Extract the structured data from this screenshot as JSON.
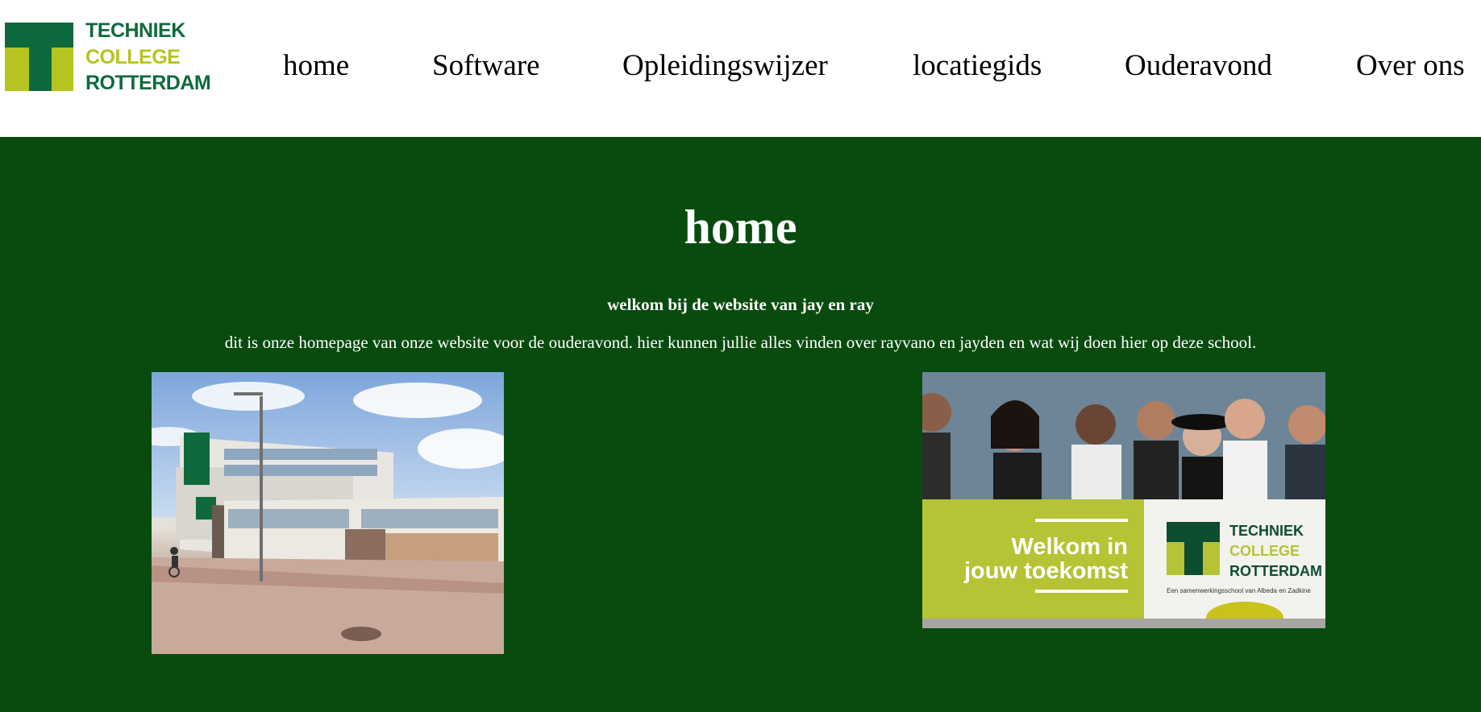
{
  "logo": {
    "line1": "TECHNIEK",
    "line2": "COLLEGE",
    "line3": "ROTTERDAM",
    "colors": {
      "green": "#0e6a3c",
      "yellow": "#b6c41f"
    }
  },
  "nav": {
    "items": [
      {
        "label": "home"
      },
      {
        "label": "Software"
      },
      {
        "label": "Opleidingswijzer"
      },
      {
        "label": "locatiegids"
      },
      {
        "label": "Ouderavond"
      },
      {
        "label": "Over ons"
      }
    ]
  },
  "main": {
    "background": "#094b0e",
    "title": "home",
    "subtitle": "welkom bij de website van jay en ray",
    "intro": "dit is onze homepage van onze website voor de ouderavond. hier kunnen jullie alles vinden over rayvano en jayden en wat wij doen hier op deze school."
  },
  "welcome_photo": {
    "banner_text_line1": "Welkom in",
    "banner_text_line2": "jouw toekomst",
    "logo_line1": "TECHNIEK",
    "logo_line2": "COLLEGE",
    "logo_line3": "ROTTERDAM",
    "caption": "Een samenwerkingsschool van Albeda en Zadkine"
  }
}
